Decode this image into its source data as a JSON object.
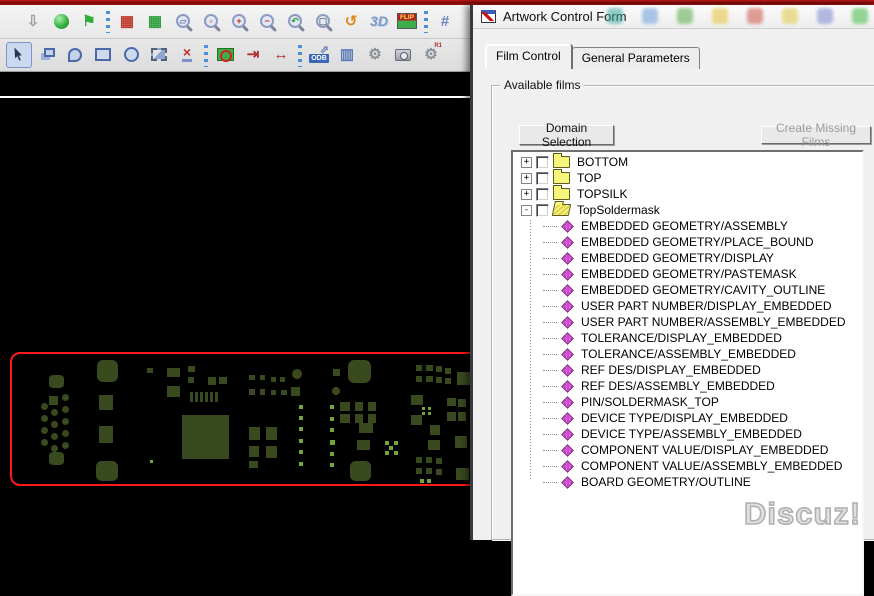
{
  "window": {
    "app_strip": ""
  },
  "toolbar": {
    "row1": [
      {
        "name": "import-icon",
        "kind": "glyph",
        "glyph": "⇩",
        "color": "#9aa0a6"
      },
      {
        "name": "shove-sphere-icon",
        "kind": "ball"
      },
      {
        "name": "pin-icon",
        "kind": "glyph",
        "glyph": "⚑",
        "color": "#2fae3a"
      },
      {
        "kind": "sep"
      },
      {
        "name": "rats-all-icon",
        "kind": "glyph",
        "glyph": "▦",
        "color": "#c0392b"
      },
      {
        "name": "unrats-all-icon",
        "kind": "glyph",
        "glyph": "▦",
        "color": "#2e9e3e"
      },
      {
        "name": "zoom-points-icon",
        "kind": "mag",
        "glyph": "▱",
        "color": "#6b84b8"
      },
      {
        "name": "zoom-fit-icon",
        "kind": "mag",
        "glyph": "▫",
        "color": "#cc2222"
      },
      {
        "name": "zoom-in-icon",
        "kind": "mag",
        "glyph": "+",
        "color": "#cc2222"
      },
      {
        "name": "zoom-out-icon",
        "kind": "mag",
        "glyph": "−",
        "color": "#cc2222"
      },
      {
        "name": "zoom-previous-icon",
        "kind": "mag",
        "glyph": "↶",
        "color": "#2e9e3e"
      },
      {
        "name": "zoom-selection-icon",
        "kind": "mag",
        "glyph": "▢",
        "color": "#777777"
      },
      {
        "name": "undo-icon",
        "kind": "glyph",
        "glyph": "↺",
        "color": "#e08a1e"
      },
      {
        "name": "view-3d-icon",
        "kind": "text3d",
        "label": "3D"
      },
      {
        "name": "flip-board-icon",
        "kind": "flip",
        "label": "FLIP"
      },
      {
        "kind": "sep"
      },
      {
        "name": "grid-toggle-icon",
        "kind": "glyph",
        "glyph": "#",
        "color": "#6b84b8"
      }
    ],
    "row2": [
      {
        "name": "select-cursor-icon",
        "kind": "cursor",
        "pressed": true
      },
      {
        "name": "copy-shape-icon",
        "kind": "shapestack"
      },
      {
        "name": "arc-shape-icon",
        "kind": "shapearc"
      },
      {
        "name": "rect-shape-icon",
        "kind": "shaperect"
      },
      {
        "name": "circle-shape-icon",
        "kind": "shapecircle"
      },
      {
        "name": "select-shape-icon",
        "kind": "shapedashed"
      },
      {
        "name": "delete-icon",
        "kind": "delx",
        "glyph": "×"
      },
      {
        "kind": "sep"
      },
      {
        "name": "board-view-icon",
        "kind": "board"
      },
      {
        "name": "dimension-edge-icon",
        "kind": "glyph",
        "glyph": "⇥",
        "color": "#b03030"
      },
      {
        "name": "dimension-span-icon",
        "kind": "glyph",
        "glyph": "↔",
        "color": "#b03030"
      },
      {
        "kind": "sep"
      },
      {
        "name": "odb-export-icon",
        "kind": "odb",
        "label": "ODB"
      },
      {
        "name": "column-view-icon",
        "kind": "glyph",
        "glyph": "▥",
        "color": "#5b79b8"
      },
      {
        "name": "tools-icon",
        "kind": "glyph",
        "glyph": "⚙",
        "color": "#8a9099"
      },
      {
        "name": "snapshot-icon",
        "kind": "camera"
      },
      {
        "name": "fix-r1-icon",
        "kind": "glyph",
        "glyph": "⚙",
        "color": "#8a9099",
        "sub": "R1"
      }
    ]
  },
  "canvas": {
    "board_outline_color": "#ff1a1a",
    "pad_color": "#3a4a1f",
    "bright_pad_color": "#74a43c",
    "pads": [
      [
        "o",
        49,
        303,
        15,
        13
      ],
      [
        "o",
        49,
        380,
        15,
        13
      ],
      [
        "r",
        49,
        324,
        9,
        9
      ],
      [
        "c",
        41,
        331,
        7,
        7
      ],
      [
        "c",
        41,
        343,
        7,
        7
      ],
      [
        "c",
        41,
        355,
        7,
        7
      ],
      [
        "c",
        41,
        367,
        7,
        7
      ],
      [
        "c",
        51,
        337,
        7,
        7
      ],
      [
        "c",
        51,
        349,
        7,
        7
      ],
      [
        "c",
        51,
        361,
        7,
        7
      ],
      [
        "c",
        51,
        373,
        7,
        7
      ],
      [
        "c",
        62,
        322,
        7,
        7
      ],
      [
        "c",
        62,
        334,
        7,
        7
      ],
      [
        "c",
        62,
        346,
        7,
        7
      ],
      [
        "c",
        62,
        358,
        7,
        7
      ],
      [
        "c",
        62,
        370,
        7,
        7
      ],
      [
        "o",
        97,
        288,
        21,
        22
      ],
      [
        "r",
        99,
        323,
        14,
        15
      ],
      [
        "r",
        99,
        354,
        14,
        17
      ],
      [
        "o",
        96,
        389,
        22,
        20
      ],
      [
        "r",
        147,
        296,
        6,
        5
      ],
      [
        "r",
        167,
        296,
        13,
        9
      ],
      [
        "r",
        188,
        294,
        7,
        6
      ],
      [
        "r",
        188,
        305,
        6,
        6
      ],
      [
        "r",
        167,
        314,
        13,
        11
      ],
      [
        "r",
        208,
        305,
        8,
        8
      ],
      [
        "r",
        219,
        305,
        8,
        7
      ],
      [
        "r",
        190,
        320,
        3,
        10
      ],
      [
        "r",
        195,
        320,
        3,
        10
      ],
      [
        "r",
        200,
        320,
        3,
        10
      ],
      [
        "r",
        205,
        320,
        3,
        10
      ],
      [
        "r",
        210,
        320,
        3,
        10
      ],
      [
        "r",
        215,
        320,
        3,
        10
      ],
      [
        "r",
        182,
        343,
        47,
        44
      ],
      [
        "b",
        150,
        388,
        3,
        3
      ],
      [
        "r",
        249,
        303,
        6,
        5
      ],
      [
        "r",
        260,
        303,
        5,
        5
      ],
      [
        "r",
        271,
        305,
        5,
        5
      ],
      [
        "r",
        280,
        305,
        5,
        5
      ],
      [
        "r",
        249,
        317,
        6,
        6
      ],
      [
        "r",
        260,
        317,
        5,
        6
      ],
      [
        "r",
        271,
        318,
        5,
        5
      ],
      [
        "r",
        281,
        318,
        6,
        5
      ],
      [
        "r",
        249,
        355,
        11,
        13
      ],
      [
        "r",
        266,
        355,
        11,
        13
      ],
      [
        "r",
        249,
        374,
        10,
        11
      ],
      [
        "r",
        266,
        374,
        11,
        12
      ],
      [
        "r",
        249,
        389,
        9,
        7
      ],
      [
        "c",
        292,
        297,
        10,
        10
      ],
      [
        "r",
        291,
        315,
        9,
        9
      ],
      [
        "r",
        333,
        297,
        7,
        7
      ],
      [
        "o",
        348,
        288,
        23,
        23
      ],
      [
        "c",
        332,
        315,
        8,
        8
      ],
      [
        "b",
        299,
        333,
        4,
        4
      ],
      [
        "b",
        299,
        344,
        4,
        4
      ],
      [
        "b",
        299,
        355,
        4,
        4
      ],
      [
        "b",
        299,
        367,
        4,
        4
      ],
      [
        "b",
        299,
        378,
        4,
        4
      ],
      [
        "b",
        299,
        390,
        4,
        4
      ],
      [
        "b",
        330,
        333,
        4,
        4
      ],
      [
        "b",
        330,
        345,
        4,
        4
      ],
      [
        "b",
        330,
        356,
        4,
        4
      ],
      [
        "b",
        330,
        368,
        5,
        5
      ],
      [
        "b",
        330,
        380,
        4,
        4
      ],
      [
        "b",
        330,
        391,
        4,
        4
      ],
      [
        "r",
        340,
        330,
        10,
        9
      ],
      [
        "r",
        355,
        330,
        8,
        9
      ],
      [
        "r",
        368,
        330,
        8,
        9
      ],
      [
        "r",
        340,
        342,
        10,
        9
      ],
      [
        "r",
        355,
        342,
        8,
        9
      ],
      [
        "r",
        368,
        342,
        8,
        9
      ],
      [
        "r",
        359,
        351,
        14,
        10
      ],
      [
        "r",
        357,
        368,
        13,
        10
      ],
      [
        "o",
        350,
        389,
        21,
        20
      ],
      [
        "b",
        385,
        369,
        4,
        4
      ],
      [
        "b",
        394,
        369,
        4,
        4
      ],
      [
        "b",
        389,
        374,
        4,
        4
      ],
      [
        "b",
        385,
        379,
        4,
        4
      ],
      [
        "b",
        394,
        379,
        4,
        4
      ],
      [
        "r",
        416,
        293,
        6,
        6
      ],
      [
        "r",
        426,
        293,
        7,
        6
      ],
      [
        "r",
        436,
        294,
        6,
        6
      ],
      [
        "r",
        445,
        296,
        6,
        6
      ],
      [
        "r",
        416,
        304,
        6,
        6
      ],
      [
        "r",
        426,
        304,
        7,
        6
      ],
      [
        "r",
        436,
        305,
        6,
        6
      ],
      [
        "r",
        445,
        306,
        6,
        6
      ],
      [
        "r",
        457,
        300,
        15,
        13
      ],
      [
        "r",
        411,
        323,
        12,
        10
      ],
      [
        "r",
        411,
        343,
        11,
        10
      ],
      [
        "b",
        422,
        335,
        3,
        3
      ],
      [
        "b",
        428,
        335,
        3,
        3
      ],
      [
        "b",
        422,
        340,
        3,
        3
      ],
      [
        "b",
        428,
        340,
        3,
        3
      ],
      [
        "r",
        430,
        353,
        10,
        10
      ],
      [
        "r",
        428,
        368,
        12,
        10
      ],
      [
        "r",
        447,
        326,
        9,
        8
      ],
      [
        "r",
        458,
        327,
        8,
        8
      ],
      [
        "r",
        447,
        340,
        9,
        9
      ],
      [
        "r",
        458,
        340,
        8,
        9
      ],
      [
        "r",
        455,
        364,
        12,
        12
      ],
      [
        "r",
        456,
        396,
        13,
        12
      ],
      [
        "r",
        416,
        385,
        6,
        6
      ],
      [
        "r",
        426,
        385,
        6,
        6
      ],
      [
        "r",
        436,
        386,
        6,
        6
      ],
      [
        "r",
        416,
        396,
        6,
        6
      ],
      [
        "r",
        426,
        396,
        6,
        6
      ],
      [
        "r",
        436,
        397,
        6,
        6
      ],
      [
        "b",
        420,
        407,
        4,
        4
      ],
      [
        "b",
        427,
        407,
        4,
        4
      ]
    ]
  },
  "dialog": {
    "title": "Artwork Control Form",
    "titlebar_ghosts": [
      "#3aa8a0",
      "#6a9fd8",
      "#55aa44",
      "#e8c13a",
      "#cc5544",
      "#e0c840",
      "#7788cc",
      "#44bb44"
    ],
    "tabs": [
      {
        "label": "Film Control",
        "active": true
      },
      {
        "label": "General Parameters",
        "active": false
      }
    ],
    "group_label": "Available films",
    "buttons": {
      "domain_selection": "Domain Selection",
      "create_missing": "Create Missing Films"
    },
    "tree": [
      {
        "label": "BOTTOM",
        "level": 0,
        "icon": "folder",
        "expander": "+",
        "checkbox": true
      },
      {
        "label": "TOP",
        "level": 0,
        "icon": "folder",
        "expander": "+",
        "checkbox": true
      },
      {
        "label": "TOPSILK",
        "level": 0,
        "icon": "folder",
        "expander": "+",
        "checkbox": true
      },
      {
        "label": "TopSoldermask",
        "level": 0,
        "icon": "folder-open",
        "expander": "-",
        "checkbox": true
      },
      {
        "label": "EMBEDDED GEOMETRY/ASSEMBLY",
        "level": 1,
        "icon": "film"
      },
      {
        "label": "EMBEDDED GEOMETRY/PLACE_BOUND",
        "level": 1,
        "icon": "film"
      },
      {
        "label": "EMBEDDED GEOMETRY/DISPLAY",
        "level": 1,
        "icon": "film"
      },
      {
        "label": "EMBEDDED GEOMETRY/PASTEMASK",
        "level": 1,
        "icon": "film"
      },
      {
        "label": "EMBEDDED GEOMETRY/CAVITY_OUTLINE",
        "level": 1,
        "icon": "film"
      },
      {
        "label": "USER PART NUMBER/DISPLAY_EMBEDDED",
        "level": 1,
        "icon": "film"
      },
      {
        "label": "USER PART NUMBER/ASSEMBLY_EMBEDDED",
        "level": 1,
        "icon": "film"
      },
      {
        "label": "TOLERANCE/DISPLAY_EMBEDDED",
        "level": 1,
        "icon": "film"
      },
      {
        "label": "TOLERANCE/ASSEMBLY_EMBEDDED",
        "level": 1,
        "icon": "film"
      },
      {
        "label": "REF DES/DISPLAY_EMBEDDED",
        "level": 1,
        "icon": "film"
      },
      {
        "label": "REF DES/ASSEMBLY_EMBEDDED",
        "level": 1,
        "icon": "film"
      },
      {
        "label": "PIN/SOLDERMASK_TOP",
        "level": 1,
        "icon": "film"
      },
      {
        "label": "DEVICE TYPE/DISPLAY_EMBEDDED",
        "level": 1,
        "icon": "film"
      },
      {
        "label": "DEVICE TYPE/ASSEMBLY_EMBEDDED",
        "level": 1,
        "icon": "film"
      },
      {
        "label": "COMPONENT VALUE/DISPLAY_EMBEDDED",
        "level": 1,
        "icon": "film"
      },
      {
        "label": "COMPONENT VALUE/ASSEMBLY_EMBEDDED",
        "level": 1,
        "icon": "film"
      },
      {
        "label": "BOARD GEOMETRY/OUTLINE",
        "level": 1,
        "icon": "film"
      }
    ]
  },
  "watermark": "Discuz!"
}
